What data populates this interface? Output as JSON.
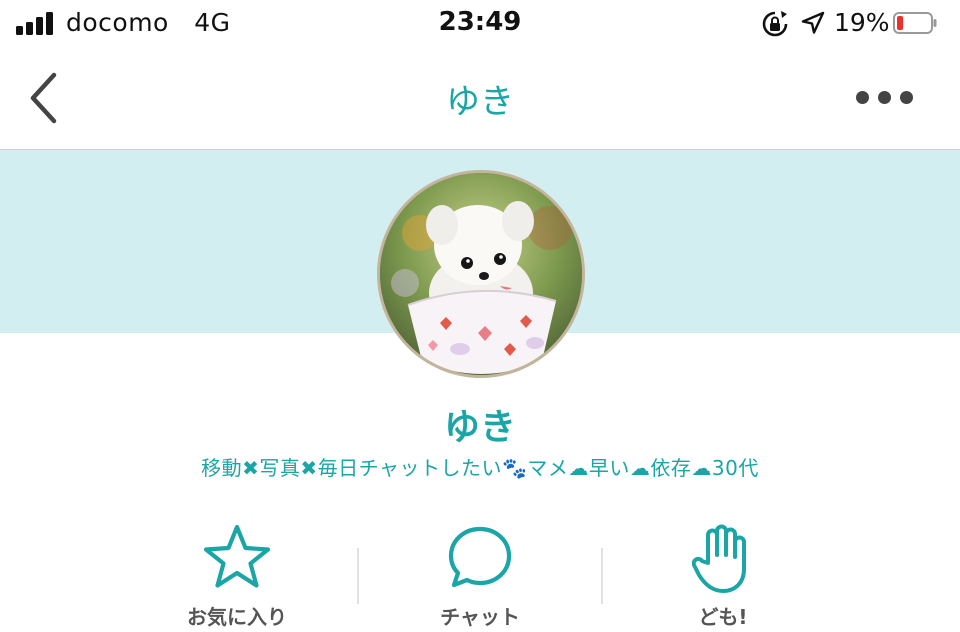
{
  "status_bar": {
    "carrier": "docomo",
    "network": "4G",
    "time": "23:49",
    "battery_percent_label": "19%",
    "battery_level": 0.19,
    "battery_color": "#e8322f",
    "icons": [
      "signal-icon",
      "orientation-lock-icon",
      "location-arrow-icon",
      "battery-icon"
    ]
  },
  "nav": {
    "title": "ゆき",
    "back_icon": "chevron-left-icon",
    "more_icon": "more-dots-icon"
  },
  "profile": {
    "name": "ゆき",
    "bio": "移動✖写真✖毎日チャットしたい🐾マメ☁早い☁依存☁30代",
    "avatar": "puppy-photo",
    "cover_color": "#d2eef0",
    "accent_color": "#1ba5a6"
  },
  "actions": [
    {
      "label": "お気に入り",
      "icon": "star-icon"
    },
    {
      "label": "チャット",
      "icon": "chat-bubble-icon"
    },
    {
      "label": "ども!",
      "icon": "hand-icon"
    }
  ]
}
